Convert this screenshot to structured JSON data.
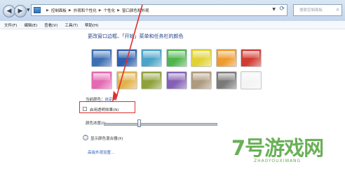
{
  "address_bar": {
    "breadcrumbs": [
      "控制面板",
      "外观和个性化",
      "个性化",
      "窗口颜色和外观"
    ],
    "search_placeholder": "搜索控制面板"
  },
  "menu": [
    "文件(F)",
    "编辑(E)",
    "查看(V)",
    "工具(T)",
    "帮助(H)"
  ],
  "main": {
    "heading": "更改窗口边框、「开始」菜单和任务栏的颜色",
    "swatches_row1": [
      "#3d6fb3",
      "#2e5fae",
      "#4aa3c8",
      "#4fb54f",
      "#e0d235",
      "#ee9a2e",
      "#d23b32"
    ],
    "swatches_row2": [
      "#e469b2",
      "#e2b24a",
      "#8fa13a",
      "#8560b4",
      "#ad9a7f",
      "#7c7a78",
      "#f4f4f4"
    ],
    "current_color_prefix": "当前颜色：",
    "current_color_value": "自定义",
    "transparency_label": "启用透明效果(N)",
    "transparency_checked": false,
    "intensity_label": "颜色浓度(I):",
    "intensity_level": 0.3,
    "color_mixer_label": "显示颜色混合器(X)",
    "advanced_link": "高级外观设置..."
  },
  "watermark": {
    "text": "7号游戏网",
    "subtext": "ZHAOYOUXIWANG"
  },
  "colors": {
    "highlight_box": "#e0302c",
    "watermark": "#4fa33a"
  }
}
